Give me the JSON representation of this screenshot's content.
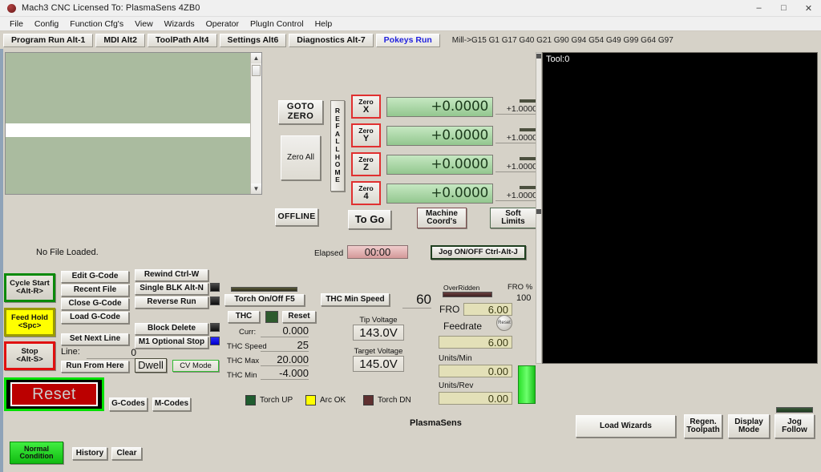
{
  "window": {
    "title": "Mach3 CNC  Licensed To:   PlasmaSens 4ZB0",
    "minimize": "–",
    "maximize": "□",
    "close": "✕"
  },
  "menu": [
    "File",
    "Config",
    "Function Cfg's",
    "View",
    "Wizards",
    "Operator",
    "PlugIn Control",
    "Help"
  ],
  "tabs": [
    {
      "label": "Program Run Alt-1",
      "active": false
    },
    {
      "label": "MDI Alt2",
      "active": false
    },
    {
      "label": "ToolPath Alt4",
      "active": false
    },
    {
      "label": "Settings Alt6",
      "active": false
    },
    {
      "label": "Diagnostics Alt-7",
      "active": false
    },
    {
      "label": "Pokeys Run",
      "active": true
    }
  ],
  "gcode_status": "Mill->G15  G1 G17 G40 G21 G90 G94 G54 G49 G99 G64 G97",
  "dro": {
    "goto_zero": "GOTO ZERO",
    "zero_all": "Zero All",
    "ref_all_home": "REF ALL HOME",
    "axes": [
      {
        "zero_label": "Zero",
        "axis": "X",
        "value": "+0.0000",
        "scale": "+1.0000"
      },
      {
        "zero_label": "Zero",
        "axis": "Y",
        "value": "+0.0000",
        "scale": "+1.0000"
      },
      {
        "zero_label": "Zero",
        "axis": "Z",
        "value": "+0.0000",
        "scale": "+1.0000"
      },
      {
        "zero_label": "Zero",
        "axis": "4",
        "value": "+0.0000",
        "scale": "+1.0000"
      }
    ],
    "offline": "OFFLINE",
    "to_go": "To Go",
    "machine_coords_1": "Machine",
    "machine_coords_2": "Coord's",
    "soft_limits_1": "Soft",
    "soft_limits_2": "Limits"
  },
  "file": {
    "status": "No File Loaded.",
    "elapsed_label": "Elapsed",
    "elapsed_value": "00:00",
    "jog_toggle": "Jog ON/OFF Ctrl-Alt-J"
  },
  "control": {
    "cycle_start_1": "Cycle Start",
    "cycle_start_2": "<Alt-R>",
    "feed_hold_1": "Feed Hold",
    "feed_hold_2": "<Spc>",
    "stop_1": "Stop",
    "stop_2": "<Alt-S>",
    "reset": "Reset",
    "normal_1": "Normal",
    "normal_2": "Condition",
    "history": "History",
    "clear": "Clear",
    "edit_gcode": "Edit G-Code",
    "recent_file": "Recent File",
    "close_gcode": "Close G-Code",
    "load_gcode": "Load G-Code",
    "rewind": "Rewind Ctrl-W",
    "single_blk": "Single BLK Alt-N",
    "reverse_run": "Reverse Run",
    "block_delete": "Block Delete",
    "m1_optional_stop": "M1 Optional Stop",
    "set_next_line": "Set Next Line",
    "line_label": "Line:",
    "line_value": "0",
    "run_from_here": "Run From Here",
    "dwell": "Dwell",
    "cv_mode": "CV Mode",
    "gcodes": "G-Codes",
    "mcodes": "M-Codes"
  },
  "thc": {
    "torch_on_off": "Torch On/Off F5",
    "thc_button": "THC",
    "reset_button": "Reset",
    "curr_label": "Curr:",
    "curr_value": "0.000",
    "speed_label": "THC Speed",
    "speed_value": "25",
    "max_label": "THC Max",
    "max_value": "20.000",
    "min_label": "THC Min",
    "min_value": "-4.000",
    "min_speed_label": "THC Min Speed",
    "min_speed_value": "60",
    "tip_voltage_label": "Tip Voltage",
    "tip_voltage_value": "143.0V",
    "target_voltage_label": "Target Voltage",
    "target_voltage_value": "145.0V"
  },
  "feed": {
    "overridden": "OverRidden",
    "fro_label": "FRO",
    "fro_value": "6.00",
    "fro_pct_label": "FRO %",
    "fro_pct_value": "100",
    "feedrate_label": "Feedrate",
    "feedrate_value": "6.00",
    "reset_knob": "Reset",
    "units_min_label": "Units/Min",
    "units_min_value": "0.00",
    "units_rev_label": "Units/Rev",
    "units_rev_value": "0.00"
  },
  "indicators": [
    {
      "name": "Torch UP",
      "color": "#1f5c2f"
    },
    {
      "name": "Arc OK",
      "color": "#ffff00"
    },
    {
      "name": "Torch DN",
      "color": "#5f3030"
    }
  ],
  "toolpath": {
    "tool_label": "Tool:0"
  },
  "branding": "PlasmaSens",
  "bottom": {
    "load_wizards": "Load Wizards",
    "regen_1": "Regen.",
    "regen_2": "Toolpath",
    "display_1": "Display",
    "display_2": "Mode",
    "jog_1": "Jog",
    "jog_2": "Follow"
  }
}
